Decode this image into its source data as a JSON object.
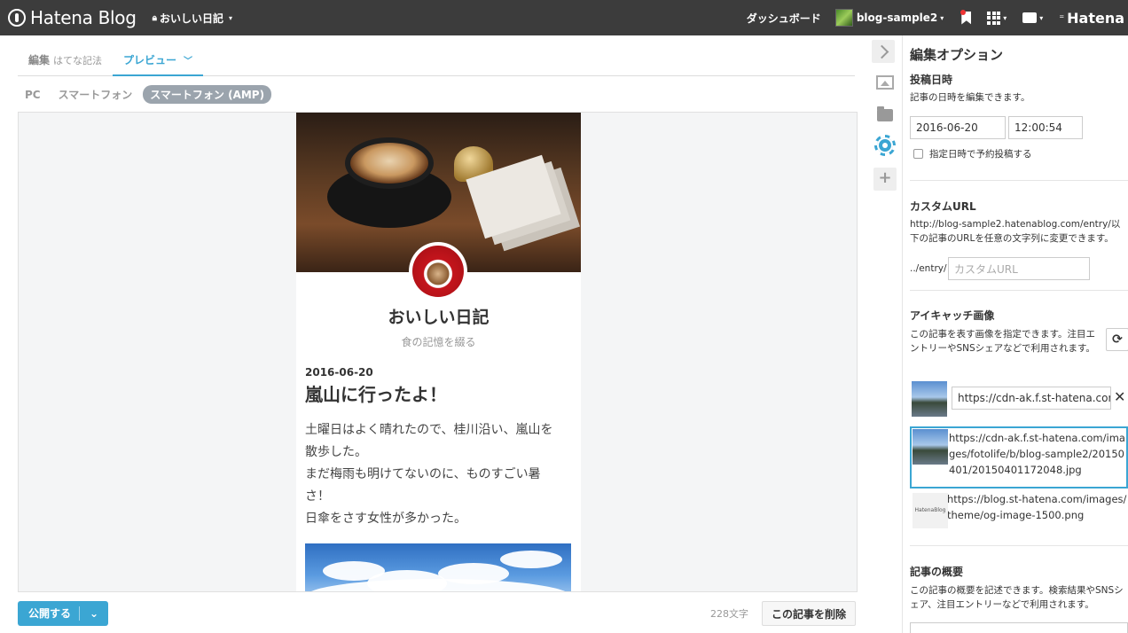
{
  "topbar": {
    "logo": "Hatena Blog",
    "blog_name": "おいしい日記",
    "dashboard": "ダッシュボード",
    "user": "blog-sample2",
    "brand_right": "Hatena"
  },
  "editor": {
    "tabs": [
      {
        "label": "編集",
        "sub": "はてな記法"
      },
      {
        "label": "プレビュー"
      }
    ],
    "devices": [
      "PC",
      "スマートフォン",
      "スマートフォン (AMP)"
    ]
  },
  "preview": {
    "blog_title": "おいしい日記",
    "blog_subtitle": "食の記憶を綴る",
    "entry_date": "2016-06-20",
    "entry_title": "嵐山に行ったよ！",
    "body_lines": [
      "土曜日はよく晴れたので、桂川沿い、嵐山を",
      "散歩した。",
      "まだ梅雨も明けてないのに、ものすごい暑",
      "さ！",
      "日傘をさす女性が多かった。"
    ]
  },
  "bottom": {
    "publish": "公開する",
    "char_count": "228文字",
    "delete": "この記事を削除"
  },
  "options": {
    "title": "編集オプション",
    "datetime": {
      "heading": "投稿日時",
      "desc": "記事の日時を編集できます。",
      "date": "2016-06-20",
      "time": "12:00:54",
      "schedule_label": "指定日時で予約投稿する"
    },
    "custom_url": {
      "heading": "カスタムURL",
      "desc": "http://blog-sample2.hatenablog.com/entry/以下の記事のURLを任意の文字列に変更できます。",
      "prefix": "../entry/",
      "placeholder": "カスタムURL"
    },
    "eyecatch": {
      "heading": "アイキャッチ画像",
      "desc": "この記事を表す画像を指定できます。注目エントリーやSNSシェアなどで利用されます。",
      "url_value": "https://cdn-ak.f.st-hatena.com/",
      "candidates": [
        "https://cdn-ak.f.st-hatena.com/images/fotolife/b/blog-sample2/20150401/20150401172048.jpg",
        "https://blog.st-hatena.com/images/theme/og-image-1500.png"
      ],
      "thumb_label": "HatenaBlog"
    },
    "summary": {
      "heading": "記事の概要",
      "desc": "この記事の概要を記述できます。検索結果やSNSシェア、注目エントリーなどで利用されます。"
    }
  },
  "colors": {
    "accent": "#3ba6d3",
    "topbar": "#3c3c3c"
  }
}
